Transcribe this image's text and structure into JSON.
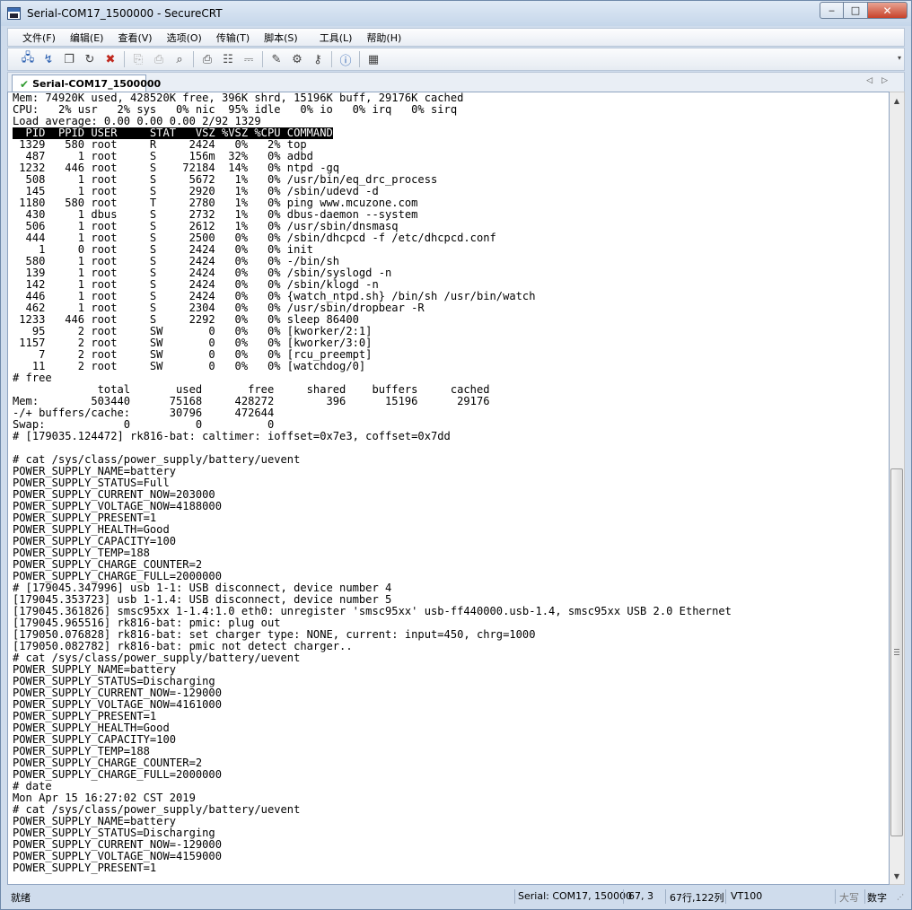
{
  "window": {
    "title": "Serial-COM17_1500000 - SecureCRT",
    "minimize_label": "‒",
    "maximize_label": "□",
    "close_label": "✕"
  },
  "menu": [
    "文件(F)",
    "编辑(E)",
    "查看(V)",
    "选项(O)",
    "传输(T)",
    "脚本(S)",
    "工具(L)",
    "帮助(H)"
  ],
  "toolbar_icons": [
    "connect-icon",
    "quick-connect-icon",
    "connect-in-tab-icon",
    "reconnect-icon",
    "disconnect-icon",
    "copy-icon",
    "paste-icon",
    "find-icon",
    "print-icon",
    "print-setup-icon",
    "print-screen-icon",
    "session-options-icon",
    "global-options-icon",
    "keymap-icon",
    "help-icon",
    "sftp-icon"
  ],
  "tab": {
    "label": "Serial-COM17_1500000"
  },
  "terminal": {
    "lines": [
      "Mem: 74920K used, 428520K free, 396K shrd, 15196K buff, 29176K cached",
      "CPU:   2% usr   2% sys   0% nic  95% idle   0% io   0% irq   0% sirq",
      "Load average: 0.00 0.00 0.00 2/92 1329",
      "  PID  PPID USER     STAT   VSZ %VSZ %CPU COMMAND",
      " 1329   580 root     R     2424   0%   2% top",
      "  487     1 root     S     156m  32%   0% adbd",
      " 1232   446 root     S    72184  14%   0% ntpd -gq",
      "  508     1 root     S     5672   1%   0% /usr/bin/eq_drc_process",
      "  145     1 root     S     2920   1%   0% /sbin/udevd -d",
      " 1180   580 root     T     2780   1%   0% ping www.mcuzone.com",
      "  430     1 dbus     S     2732   1%   0% dbus-daemon --system",
      "  506     1 root     S     2612   1%   0% /usr/sbin/dnsmasq",
      "  444     1 root     S     2500   0%   0% /sbin/dhcpcd -f /etc/dhcpcd.conf",
      "    1     0 root     S     2424   0%   0% init",
      "  580     1 root     S     2424   0%   0% -/bin/sh",
      "  139     1 root     S     2424   0%   0% /sbin/syslogd -n",
      "  142     1 root     S     2424   0%   0% /sbin/klogd -n",
      "  446     1 root     S     2424   0%   0% {watch_ntpd.sh} /bin/sh /usr/bin/watch",
      "  462     1 root     S     2304   0%   0% /usr/sbin/dropbear -R",
      " 1233   446 root     S     2292   0%   0% sleep 86400",
      "   95     2 root     SW       0   0%   0% [kworker/2:1]",
      " 1157     2 root     SW       0   0%   0% [kworker/3:0]",
      "    7     2 root     SW       0   0%   0% [rcu_preempt]",
      "   11     2 root     SW       0   0%   0% [watchdog/0]",
      "# free",
      "             total       used       free     shared    buffers     cached",
      "Mem:        503440      75168     428272        396      15196      29176",
      "-/+ buffers/cache:      30796     472644",
      "Swap:            0          0          0",
      "# [179035.124472] rk816-bat: caltimer: ioffset=0x7e3, coffset=0x7dd",
      "",
      "# cat /sys/class/power_supply/battery/uevent",
      "POWER_SUPPLY_NAME=battery",
      "POWER_SUPPLY_STATUS=Full",
      "POWER_SUPPLY_CURRENT_NOW=203000",
      "POWER_SUPPLY_VOLTAGE_NOW=4188000",
      "POWER_SUPPLY_PRESENT=1",
      "POWER_SUPPLY_HEALTH=Good",
      "POWER_SUPPLY_CAPACITY=100",
      "POWER_SUPPLY_TEMP=188",
      "POWER_SUPPLY_CHARGE_COUNTER=2",
      "POWER_SUPPLY_CHARGE_FULL=2000000",
      "# [179045.347996] usb 1-1: USB disconnect, device number 4",
      "[179045.353723] usb 1-1.4: USB disconnect, device number 5",
      "[179045.361826] smsc95xx 1-1.4:1.0 eth0: unregister 'smsc95xx' usb-ff440000.usb-1.4, smsc95xx USB 2.0 Ethernet",
      "[179045.965516] rk816-bat: pmic: plug out",
      "[179050.076828] rk816-bat: set charger type: NONE, current: input=450, chrg=1000",
      "[179050.082782] rk816-bat: pmic not detect charger..",
      "# cat /sys/class/power_supply/battery/uevent",
      "POWER_SUPPLY_NAME=battery",
      "POWER_SUPPLY_STATUS=Discharging",
      "POWER_SUPPLY_CURRENT_NOW=-129000",
      "POWER_SUPPLY_VOLTAGE_NOW=4161000",
      "POWER_SUPPLY_PRESENT=1",
      "POWER_SUPPLY_HEALTH=Good",
      "POWER_SUPPLY_CAPACITY=100",
      "POWER_SUPPLY_TEMP=188",
      "POWER_SUPPLY_CHARGE_COUNTER=2",
      "POWER_SUPPLY_CHARGE_FULL=2000000",
      "# date",
      "Mon Apr 15 16:27:02 CST 2019",
      "# cat /sys/class/power_supply/battery/uevent",
      "POWER_SUPPLY_NAME=battery",
      "POWER_SUPPLY_STATUS=Discharging",
      "POWER_SUPPLY_CURRENT_NOW=-129000",
      "POWER_SUPPLY_VOLTAGE_NOW=4159000",
      "POWER_SUPPLY_PRESENT=1"
    ]
  },
  "status": {
    "ready": "就绪",
    "connection": "Serial: COM17, 150000",
    "cursor": "67,  3",
    "size": "67行,122列",
    "emulation": "VT100",
    "caps": "大写",
    "num": "数字"
  }
}
